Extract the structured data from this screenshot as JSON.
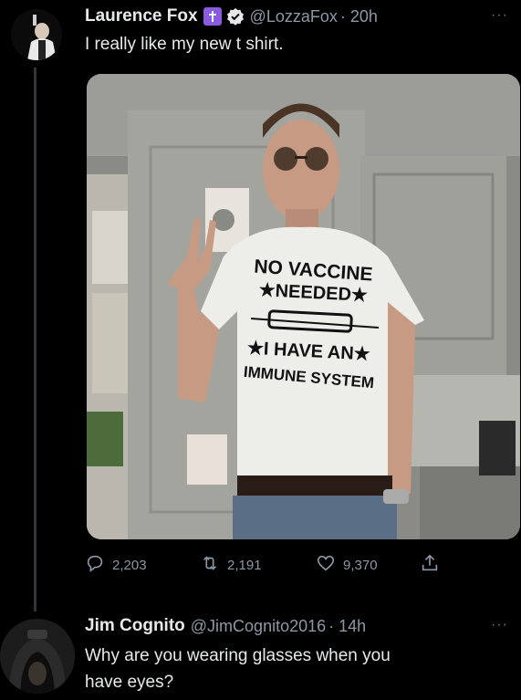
{
  "tweet": {
    "author_name": "Laurence Fox",
    "handle": "@LozzaFox",
    "time": "· 20h",
    "text": "I really like my new t shirt.",
    "more_label": "···",
    "stats": {
      "replies": "2,203",
      "retweets": "2,191",
      "likes": "9,370"
    },
    "shirt": {
      "line1": "NO VACCINE",
      "line2": "★NEEDED★",
      "line3": "★I HAVE AN★",
      "line4": "IMMUNE SYSTEM"
    }
  },
  "reply": {
    "author_name": "Jim Cognito",
    "handle": "@JimCognito2016",
    "time": "· 14h",
    "text_line1": "Why are you wearing glasses when you",
    "text_line2": "have eyes?",
    "more_label": "···"
  },
  "colors": {
    "background": "#000000",
    "text": "#e7e9ea",
    "muted": "#8b98a5",
    "badge": "#8a5adf",
    "verified": "#1d9bf0"
  },
  "icons": [
    "reply-icon",
    "retweet-icon",
    "like-icon",
    "share-icon",
    "verified-icon",
    "cross-badge-icon"
  ]
}
